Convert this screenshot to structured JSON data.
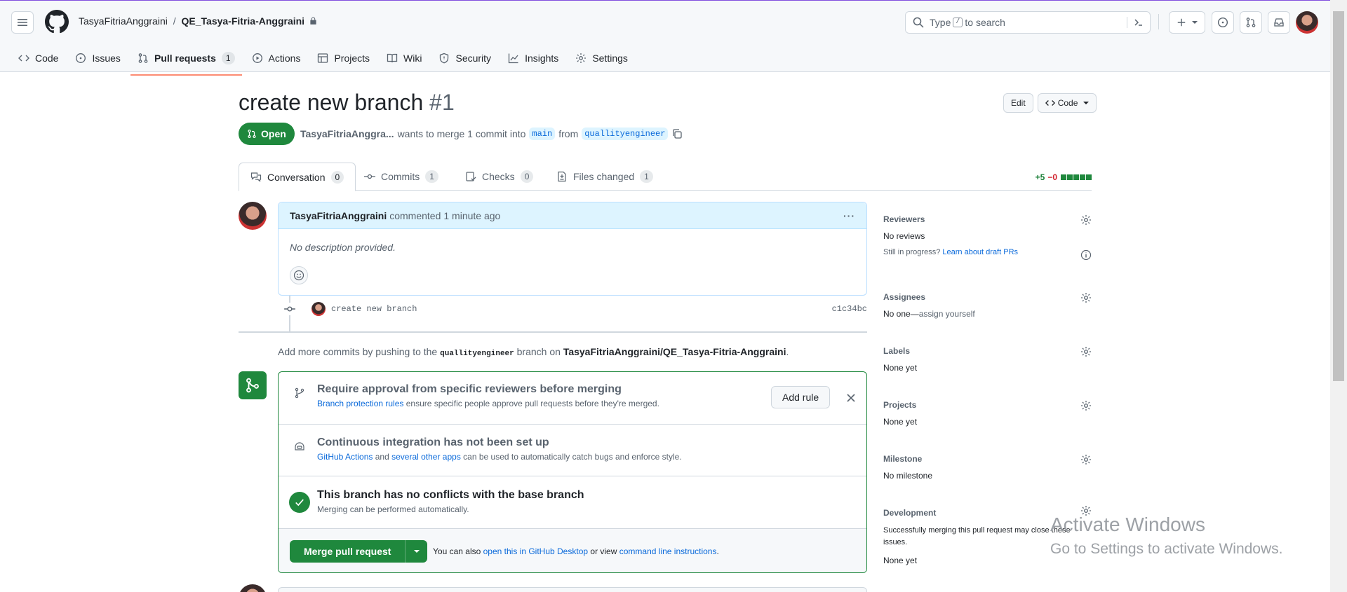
{
  "header": {
    "owner": "TasyaFitriaAnggraini",
    "separator": "/",
    "repo": "QE_Tasya-Fitria-Anggraini",
    "search": {
      "prefix": "Type",
      "key": "/",
      "suffix": "to search"
    }
  },
  "repo_nav": [
    {
      "label": "Code",
      "icon": "code-icon"
    },
    {
      "label": "Issues",
      "icon": "issue-icon"
    },
    {
      "label": "Pull requests",
      "icon": "pull-request-icon",
      "count": "1",
      "active": true
    },
    {
      "label": "Actions",
      "icon": "play-icon"
    },
    {
      "label": "Projects",
      "icon": "table-icon"
    },
    {
      "label": "Wiki",
      "icon": "book-icon"
    },
    {
      "label": "Security",
      "icon": "shield-icon"
    },
    {
      "label": "Insights",
      "icon": "graph-icon"
    },
    {
      "label": "Settings",
      "icon": "gear-icon"
    }
  ],
  "pr": {
    "title": "create new branch",
    "number": "#1",
    "edit_label": "Edit",
    "code_label": "Code",
    "state": "Open",
    "author_short": "TasyaFitriaAnggra...",
    "merge_text": "wants to merge 1 commit into",
    "base": "main",
    "from": "from",
    "head": "quallityengineer"
  },
  "tabs": [
    {
      "label": "Conversation",
      "count": "0"
    },
    {
      "label": "Commits",
      "count": "1"
    },
    {
      "label": "Checks",
      "count": "0"
    },
    {
      "label": "Files changed",
      "count": "1"
    }
  ],
  "diffstat": {
    "added": "+5",
    "removed": "−0"
  },
  "comment": {
    "author": "TasyaFitriaAnggraini",
    "action": "commented",
    "time": "1 minute ago",
    "body": "No description provided."
  },
  "commit": {
    "message": "create new branch",
    "sha": "c1c34bc"
  },
  "push_hint": {
    "prefix": "Add more commits by pushing to the",
    "branch": "quallityengineer",
    "middle": "branch on",
    "repo": "TasyaFitriaAnggraini/QE_Tasya-Fitria-Anggraini",
    "end": "."
  },
  "merge": {
    "rule_title": "Require approval from specific reviewers before merging",
    "rule_link": "Branch protection rules",
    "rule_text": "ensure specific people approve pull requests before they're merged.",
    "add_rule": "Add rule",
    "ci_title": "Continuous integration has not been set up",
    "ci_link1": "GitHub Actions",
    "ci_and": "and",
    "ci_link2": "several other apps",
    "ci_text": "can be used to automatically catch bugs and enforce style.",
    "conflict_title": "This branch has no conflicts with the base branch",
    "conflict_text": "Merging can be performed automatically.",
    "merge_button": "Merge pull request",
    "also": "You can also",
    "desktop_link": "open this in GitHub Desktop",
    "or_view": "or view",
    "cli_link": "command line instructions",
    "end": "."
  },
  "sidebar": {
    "reviewers_label": "Reviewers",
    "reviewers_value": "No reviews",
    "draft_text": "Still in progress?",
    "draft_link": "Learn about draft PRs",
    "assignees_label": "Assignees",
    "assignees_value": "No one—",
    "assignees_link": "assign yourself",
    "labels_label": "Labels",
    "labels_value": "None yet",
    "projects_label": "Projects",
    "projects_value": "None yet",
    "milestone_label": "Milestone",
    "milestone_value": "No milestone",
    "development_label": "Development",
    "development_text": "Successfully merging this pull request may close these issues.",
    "development_value": "None yet"
  },
  "watermark": {
    "line1": "Activate Windows",
    "line2": "Go to Settings to activate Windows."
  },
  "colors": {
    "accent": "#0969da",
    "success": "#1f883d",
    "danger": "#d1242f",
    "underline": "#fd8c73"
  }
}
